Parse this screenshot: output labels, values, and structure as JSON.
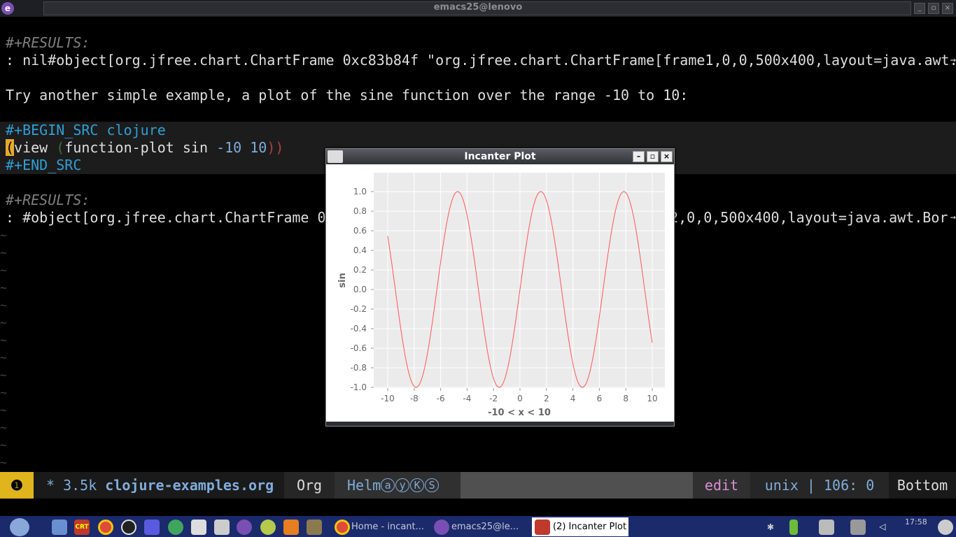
{
  "window": {
    "title": "emacs25@lenovo",
    "app_icon": "emacs-icon"
  },
  "editor": {
    "results_label_1": "#+RESULTS:",
    "results_value_1": ": nil#object[org.jfree.chart.ChartFrame 0xc83b84f \"org.jfree.chart.ChartFrame[frame1,0,0,500x400,layout=java.awt.",
    "prose": "Try another simple example, a plot of the sine function over the range -10 to 10:",
    "begin_src": "#+BEGIN_SRC clojure",
    "code": {
      "open_paren": "(",
      "fn_view": "view ",
      "open_paren2": "(",
      "fn_plot": "function-plot sin ",
      "arg1": "-10",
      "space": " ",
      "arg2": "10",
      "close_parens": "))"
    },
    "end_src": "#+END_SRC",
    "results_label_2": "#+RESULTS:",
    "results_value_2_left": ": #object[org.jfree.chart.ChartFrame 0",
    "results_value_2_right": "e2,0,0,500x400,layout=java.awt.Bor"
  },
  "modeline": {
    "window_number": "❶",
    "modified": "* 3.5k ",
    "buffer_name": "clojure-examples.org",
    "major_mode": "Org",
    "minor_mode": "Helm",
    "minor_badges": [
      "a",
      "y",
      "K",
      "S"
    ],
    "state": "edit",
    "position": "unix | 106: 0",
    "scroll": "Bottom"
  },
  "taskbar": {
    "tasks": [
      {
        "label": "Home - incant...",
        "icon": "chrome-icon"
      },
      {
        "label": "emacs25@le...",
        "icon": "emacs-icon"
      },
      {
        "label": "(2) Incanter Plot",
        "icon": "java-icon"
      }
    ],
    "clock": "17:58"
  },
  "plot_window": {
    "title": "Incanter Plot"
  },
  "chart_data": {
    "type": "line",
    "title": "",
    "xlabel": "-10 < x < 10",
    "ylabel": "sin",
    "function": "sin(x)",
    "xlim": [
      -10,
      10
    ],
    "ylim": [
      -1.0,
      1.0
    ],
    "x_ticks": [
      -10,
      -8,
      -6,
      -4,
      -2,
      0,
      2,
      4,
      6,
      8,
      10
    ],
    "y_ticks": [
      "1.0",
      "0.8",
      "0.6",
      "0.4",
      "0.2",
      "0.0",
      "-0.2",
      "-0.4",
      "-0.6",
      "-0.8",
      "-1.0"
    ],
    "series": [
      {
        "color": "#ff5555"
      }
    ],
    "grid": true,
    "legend": "none",
    "colors": {
      "plot_bg": "#ebebeb",
      "grid": "#ffffff",
      "line": "#ff5555"
    }
  }
}
